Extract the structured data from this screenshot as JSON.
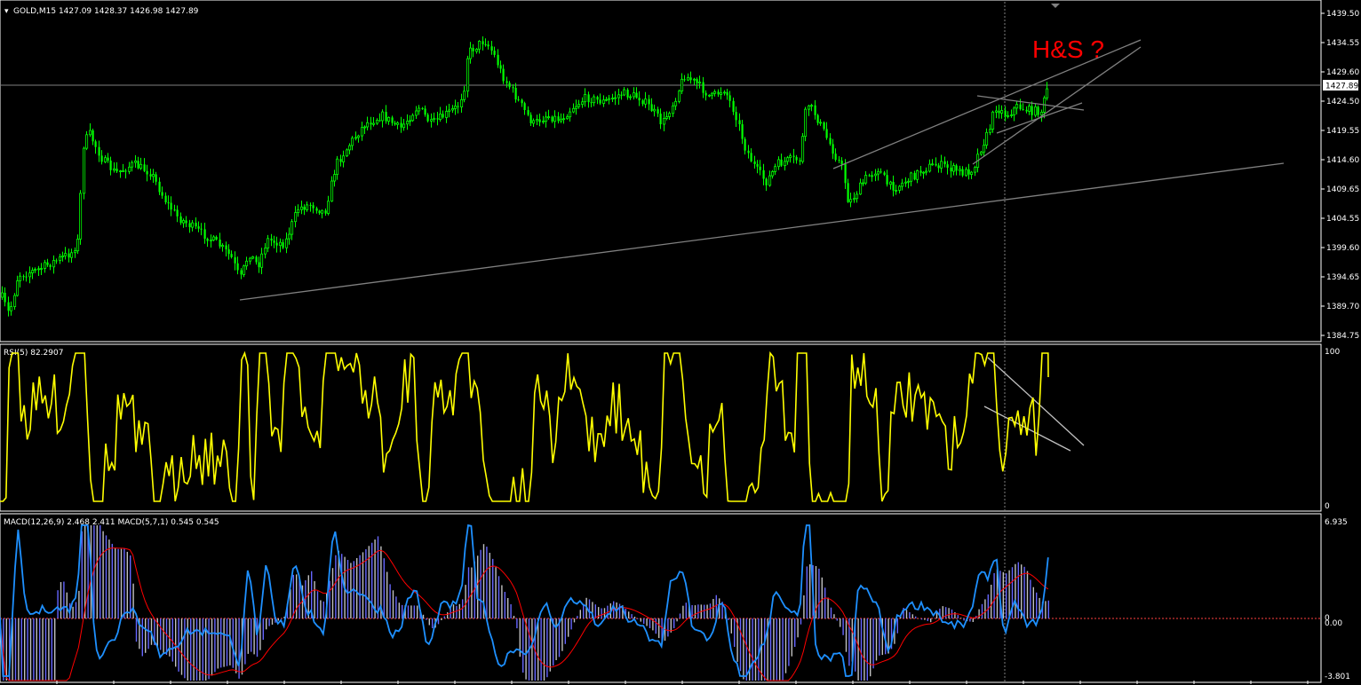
{
  "main": {
    "symbol_header": "GOLD,M15  1427.09 1428.37 1426.98 1427.89",
    "current_price_label": "1427.89",
    "annotation": "H&S ?",
    "price_axis_labels": [
      "1439.50",
      "1434.55",
      "1429.60",
      "1424.50",
      "1419.55",
      "1414.60",
      "1409.65",
      "1404.55",
      "1399.60",
      "1394.65",
      "1389.70",
      "1384.75"
    ],
    "colors": {
      "bull": "#00ff00",
      "bear": "#00ff00",
      "trendline": "#808080",
      "grid": "#6a6a6a"
    }
  },
  "rsi": {
    "header": "RSI(5) 82.2907",
    "axis_top": "100",
    "axis_bottom": "0",
    "color": "#ffff00"
  },
  "macd": {
    "header": "MACD(12,26,9) 2.468 2.411  MACD(5,7,1) 0.545 0.545",
    "axis_top": "6.935",
    "axis_zero_a": "0",
    "axis_zero_b": "0.00",
    "axis_bottom": "-3.801",
    "colors": {
      "hist_a": "#c0c0c0",
      "hist_b": "#6666ff",
      "signal": "#ff0000",
      "line": "#1e90ff"
    }
  }
}
